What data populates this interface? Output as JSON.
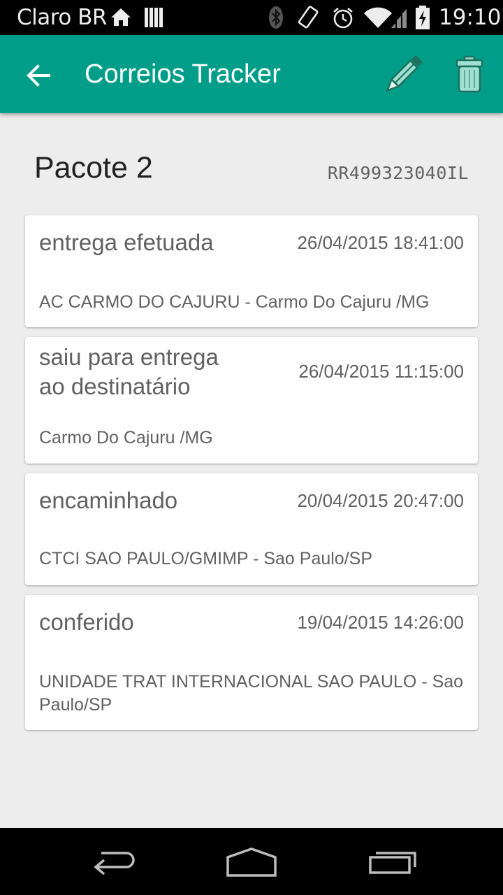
{
  "status_bar": {
    "carrier": "Claro BR",
    "time": "19:10",
    "icons": [
      "home-icon",
      "signal-bars-icon",
      "bluetooth-icon",
      "screen-rotation-icon",
      "alarm-icon",
      "wifi-icon",
      "cell-signal-icon",
      "battery-icon"
    ]
  },
  "app_bar": {
    "title": "Correios Tracker",
    "icons": [
      "back-arrow-icon",
      "pencil-icon",
      "trash-icon"
    ],
    "color": "#009e89"
  },
  "package": {
    "name": "Pacote 2",
    "code": "RR499323040IL"
  },
  "events": [
    {
      "status": "entrega efetuada",
      "date": "26/04/2015 18:41:00",
      "location": "AC CARMO DO CAJURU - Carmo Do Cajuru /MG"
    },
    {
      "status": "saiu para entrega ao destinatário",
      "date": "26/04/2015 11:15:00",
      "location": "Carmo Do Cajuru /MG"
    },
    {
      "status": "encaminhado",
      "date": "20/04/2015 20:47:00",
      "location": "CTCI SAO PAULO/GMIMP - Sao Paulo/SP"
    },
    {
      "status": "conferido",
      "date": "19/04/2015 14:26:00",
      "location": "UNIDADE TRAT INTERNACIONAL SAO PAULO - Sao Paulo/SP"
    }
  ],
  "nav_bar": {
    "icons": [
      "nav-back-icon",
      "nav-home-icon",
      "nav-recents-icon"
    ]
  }
}
